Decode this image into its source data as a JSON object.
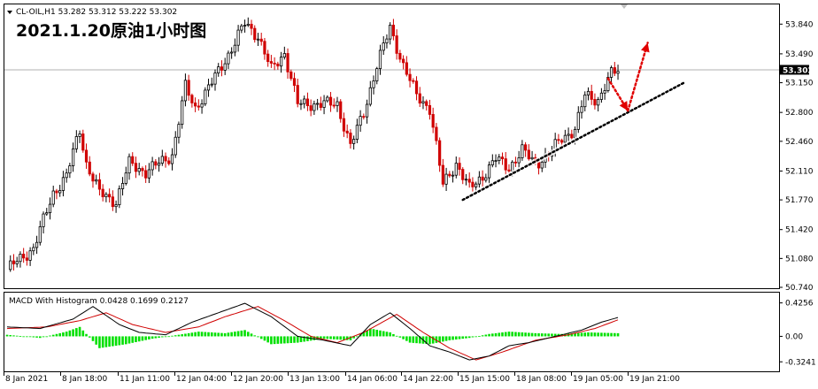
{
  "chart_data": {
    "type": "candlestick",
    "title": "2021.1.20原油1小时图",
    "symbol_info": "CL-OIL,H1  53.282 53.312 53.222 53.302",
    "current_price": "53.302",
    "ylim": [
      50.74,
      54.02
    ],
    "y_ticks": [
      "53.840",
      "53.490",
      "53.150",
      "52.800",
      "52.460",
      "52.110",
      "51.770",
      "51.420",
      "51.080",
      "50.740"
    ],
    "x_ticks": [
      "8 Jan 2021",
      "8 Jan 18:00",
      "11 Jan 11:00",
      "12 Jan 04:00",
      "12 Jan 20:00",
      "13 Jan 13:00",
      "14 Jan 06:00",
      "14 Jan 22:00",
      "15 Jan 15:00",
      "18 Jan 08:00",
      "19 Jan 05:00",
      "19 Jan 21:00"
    ],
    "price_path": [
      {
        "i": 0,
        "p": 50.95
      },
      {
        "i": 8,
        "p": 51.2
      },
      {
        "i": 14,
        "p": 51.85
      },
      {
        "i": 18,
        "p": 52.05
      },
      {
        "i": 22,
        "p": 52.6
      },
      {
        "i": 24,
        "p": 52.2
      },
      {
        "i": 28,
        "p": 51.85
      },
      {
        "i": 33,
        "p": 51.75
      },
      {
        "i": 37,
        "p": 52.2
      },
      {
        "i": 42,
        "p": 52.1
      },
      {
        "i": 50,
        "p": 52.3
      },
      {
        "i": 54,
        "p": 53.1
      },
      {
        "i": 57,
        "p": 52.85
      },
      {
        "i": 62,
        "p": 53.15
      },
      {
        "i": 68,
        "p": 53.55
      },
      {
        "i": 72,
        "p": 53.85
      },
      {
        "i": 76,
        "p": 53.7
      },
      {
        "i": 80,
        "p": 53.3
      },
      {
        "i": 84,
        "p": 53.5
      },
      {
        "i": 88,
        "p": 52.9
      },
      {
        "i": 92,
        "p": 52.9
      },
      {
        "i": 96,
        "p": 52.9
      },
      {
        "i": 100,
        "p": 52.9
      },
      {
        "i": 104,
        "p": 52.4
      },
      {
        "i": 108,
        "p": 52.8
      },
      {
        "i": 112,
        "p": 53.35
      },
      {
        "i": 116,
        "p": 53.8
      },
      {
        "i": 120,
        "p": 53.35
      },
      {
        "i": 124,
        "p": 53.0
      },
      {
        "i": 128,
        "p": 52.85
      },
      {
        "i": 130,
        "p": 52.4
      },
      {
        "i": 132,
        "p": 51.95
      },
      {
        "i": 136,
        "p": 52.2
      },
      {
        "i": 140,
        "p": 51.9
      },
      {
        "i": 144,
        "p": 52.05
      },
      {
        "i": 148,
        "p": 52.25
      },
      {
        "i": 152,
        "p": 52.15
      },
      {
        "i": 156,
        "p": 52.35
      },
      {
        "i": 160,
        "p": 52.2
      },
      {
        "i": 164,
        "p": 52.3
      },
      {
        "i": 168,
        "p": 52.5
      },
      {
        "i": 172,
        "p": 52.6
      },
      {
        "i": 175,
        "p": 53.0
      },
      {
        "i": 179,
        "p": 52.95
      },
      {
        "i": 183,
        "p": 53.25
      },
      {
        "i": 185,
        "p": 53.3
      }
    ],
    "trendline": {
      "from": {
        "i": 138,
        "p": 51.77
      },
      "to": {
        "i": 205,
        "p": 53.15
      }
    },
    "forecast_arrow": {
      "points": [
        {
          "i": 182,
          "p": 53.2
        },
        {
          "i": 188,
          "p": 52.82
        },
        {
          "i": 194,
          "p": 53.62
        }
      ]
    },
    "macd": {
      "label": "MACD With Histogram 0.0428 0.1699 0.2127",
      "y_ticks": [
        "0.4256",
        "0.00",
        "-0.3241"
      ],
      "ylim": [
        -0.4,
        0.5
      ],
      "macd_line": [
        {
          "i": 0,
          "v": 0.12
        },
        {
          "i": 10,
          "v": 0.1
        },
        {
          "i": 20,
          "v": 0.22
        },
        {
          "i": 26,
          "v": 0.38
        },
        {
          "i": 34,
          "v": 0.15
        },
        {
          "i": 40,
          "v": 0.05
        },
        {
          "i": 48,
          "v": 0.02
        },
        {
          "i": 56,
          "v": 0.18
        },
        {
          "i": 64,
          "v": 0.3
        },
        {
          "i": 72,
          "v": 0.42
        },
        {
          "i": 80,
          "v": 0.25
        },
        {
          "i": 88,
          "v": 0.0
        },
        {
          "i": 96,
          "v": -0.05
        },
        {
          "i": 104,
          "v": -0.12
        },
        {
          "i": 110,
          "v": 0.15
        },
        {
          "i": 116,
          "v": 0.3
        },
        {
          "i": 122,
          "v": 0.1
        },
        {
          "i": 128,
          "v": -0.12
        },
        {
          "i": 134,
          "v": -0.2
        },
        {
          "i": 140,
          "v": -0.3
        },
        {
          "i": 146,
          "v": -0.25
        },
        {
          "i": 152,
          "v": -0.12
        },
        {
          "i": 158,
          "v": -0.08
        },
        {
          "i": 166,
          "v": 0.0
        },
        {
          "i": 174,
          "v": 0.08
        },
        {
          "i": 180,
          "v": 0.18
        },
        {
          "i": 185,
          "v": 0.24
        }
      ],
      "signal_line": [
        {
          "i": 0,
          "v": 0.1
        },
        {
          "i": 12,
          "v": 0.12
        },
        {
          "i": 22,
          "v": 0.2
        },
        {
          "i": 30,
          "v": 0.3
        },
        {
          "i": 38,
          "v": 0.15
        },
        {
          "i": 48,
          "v": 0.05
        },
        {
          "i": 58,
          "v": 0.12
        },
        {
          "i": 66,
          "v": 0.25
        },
        {
          "i": 76,
          "v": 0.38
        },
        {
          "i": 84,
          "v": 0.2
        },
        {
          "i": 92,
          "v": 0.0
        },
        {
          "i": 100,
          "v": -0.08
        },
        {
          "i": 108,
          "v": 0.05
        },
        {
          "i": 118,
          "v": 0.28
        },
        {
          "i": 126,
          "v": 0.05
        },
        {
          "i": 134,
          "v": -0.15
        },
        {
          "i": 142,
          "v": -0.3
        },
        {
          "i": 150,
          "v": -0.2
        },
        {
          "i": 160,
          "v": -0.05
        },
        {
          "i": 170,
          "v": 0.02
        },
        {
          "i": 178,
          "v": 0.1
        },
        {
          "i": 185,
          "v": 0.21
        }
      ],
      "histogram": [
        {
          "i": 0,
          "v": 0.02
        },
        {
          "i": 10,
          "v": -0.02
        },
        {
          "i": 18,
          "v": 0.06
        },
        {
          "i": 22,
          "v": 0.12
        },
        {
          "i": 28,
          "v": -0.15
        },
        {
          "i": 36,
          "v": -0.1
        },
        {
          "i": 44,
          "v": -0.03
        },
        {
          "i": 52,
          "v": 0.02
        },
        {
          "i": 58,
          "v": 0.06
        },
        {
          "i": 66,
          "v": 0.04
        },
        {
          "i": 72,
          "v": 0.08
        },
        {
          "i": 80,
          "v": -0.1
        },
        {
          "i": 88,
          "v": -0.08
        },
        {
          "i": 96,
          "v": -0.03
        },
        {
          "i": 104,
          "v": -0.05
        },
        {
          "i": 110,
          "v": 0.1
        },
        {
          "i": 116,
          "v": 0.05
        },
        {
          "i": 122,
          "v": -0.08
        },
        {
          "i": 128,
          "v": -0.1
        },
        {
          "i": 134,
          "v": -0.05
        },
        {
          "i": 140,
          "v": -0.02
        },
        {
          "i": 146,
          "v": 0.03
        },
        {
          "i": 152,
          "v": 0.06
        },
        {
          "i": 160,
          "v": 0.04
        },
        {
          "i": 168,
          "v": 0.03
        },
        {
          "i": 176,
          "v": 0.05
        },
        {
          "i": 185,
          "v": 0.04
        }
      ]
    }
  },
  "colors": {
    "bull": "#000000",
    "bear": "#d00000",
    "grid": "#c8c8c8",
    "macd_line": "#000000",
    "signal_line": "#d00000",
    "histogram": "#00e000",
    "trendline": "#000000",
    "arrow": "#e00000"
  }
}
